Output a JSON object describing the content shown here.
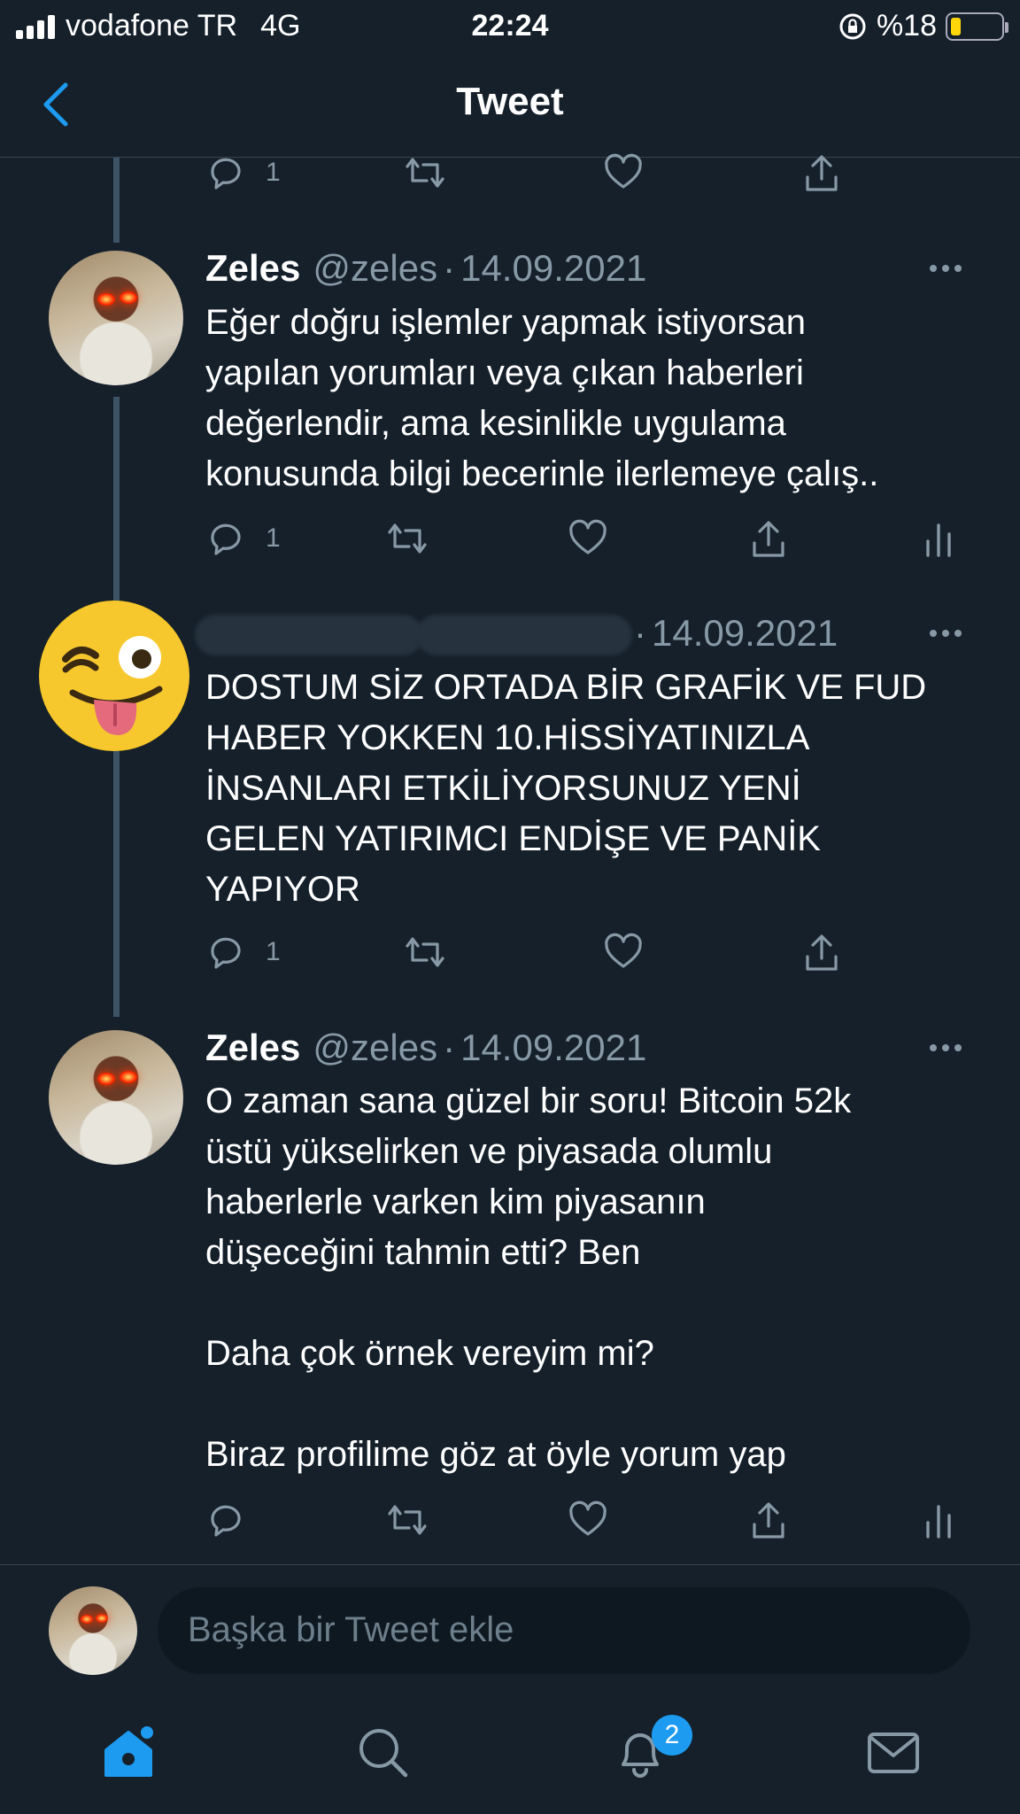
{
  "status_bar": {
    "carrier": "vodafone TR",
    "network": "4G",
    "time": "22:24",
    "battery": "%18",
    "battery_level": 0.18
  },
  "header": {
    "title": "Tweet"
  },
  "tweets": [
    {
      "reply_count": "1"
    },
    {
      "name": "Zeles",
      "handle": "@zeles",
      "separator": "·",
      "date": "14.09.2021",
      "text": "Eğer doğru işlemler yapmak istiyorsan\nyapılan yorumları veya çıkan haberleri\ndeğerlendir, ama kesinlikle uygulama\nkonusunda bilgi becerinle ilerlemeye çalış..",
      "reply_count": "1"
    },
    {
      "separator": "·",
      "date": "14.09.2021",
      "text": "DOSTUM SİZ ORTADA BİR GRAFİK VE FUD\nHABER YOKKEN 10.HİSSİYATINIZLA\nİNSANLARI ETKİLİYORSUNUZ YENİ\nGELEN YATIRIMCI ENDİŞE VE PANİK\nYAPIYOR",
      "reply_count": "1",
      "avatar_emoji": "😜"
    },
    {
      "name": "Zeles",
      "handle": "@zeles",
      "separator": "·",
      "date": "14.09.2021",
      "text": "O zaman sana güzel bir soru! Bitcoin 52k\nüstü yükselirken ve piyasada olumlu\nhaberlerle varken kim piyasanın\ndüşeceğini tahmin etti? Ben\n\nDaha çok örnek vereyim mi?\n\nBiraz profilime göz at öyle yorum yap"
    }
  ],
  "reply_bar": {
    "placeholder": "Başka bir Tweet ekle"
  },
  "tab_bar": {
    "notifications_badge": "2"
  },
  "colors": {
    "background": "#15202b",
    "accent": "#1d9bf0",
    "muted": "#8899a6"
  }
}
